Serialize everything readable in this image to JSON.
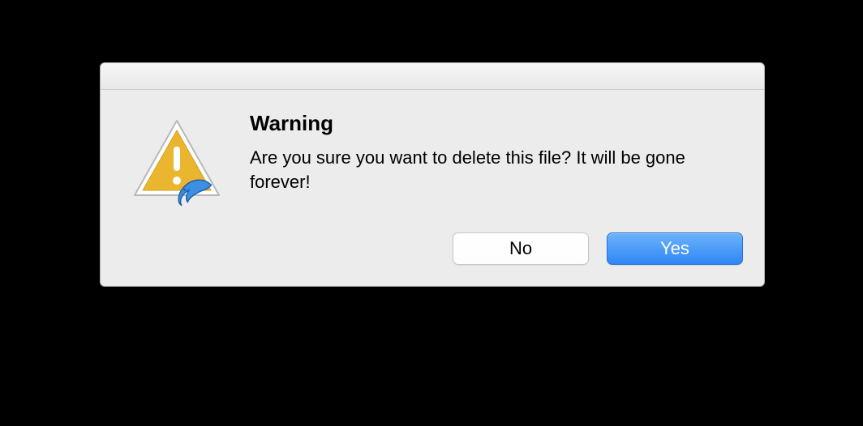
{
  "dialog": {
    "title": "Warning",
    "message": "Are you sure you want to delete this file? It will be gone forever!",
    "buttons": {
      "no": "No",
      "yes": "Yes"
    },
    "icon": {
      "name": "warning-triangle",
      "badge": "app-dolphin"
    }
  }
}
